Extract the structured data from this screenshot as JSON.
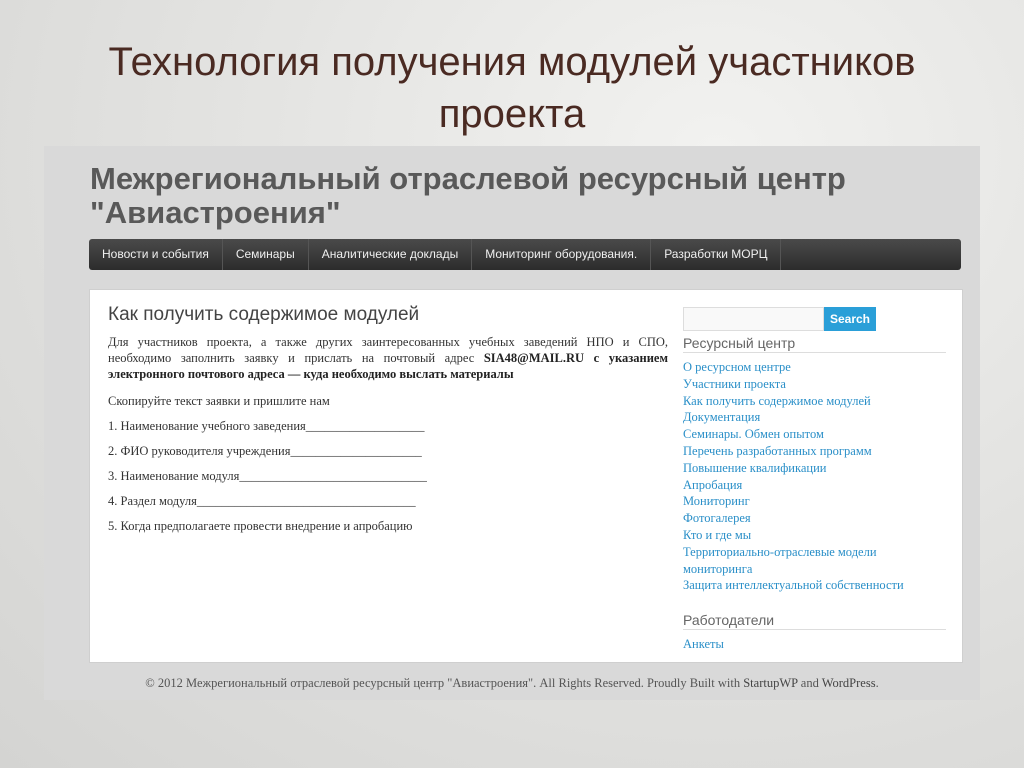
{
  "slide": {
    "title_line1": "Технология получения модулей участников",
    "title_line2": "проекта"
  },
  "site": {
    "title_line1": "Межрегиональный отраслевой ресурсный центр",
    "title_line2": "\"Авиастроения\""
  },
  "nav": {
    "items": [
      "Новости и события",
      "Семинары",
      "Аналитические доклады",
      "Мониторинг оборудования.",
      "Разработки МОРЦ"
    ]
  },
  "main": {
    "heading": "Как получить содержимое модулей",
    "intro_text": "Для участников проекта, а также других заинтересованных учебных заведений НПО и СПО, необходимо заполнить заявку и прислать на почтовый адрес ",
    "intro_bold": "SIA48@MAIL.RU с указанием электронного почтового адреса —  куда необходимо выслать материалы",
    "copy_text": "Скопируйте текст заявки и пришлите нам",
    "form_lines": [
      "1. Наименование учебного заведения___________________",
      "2. ФИО руководителя учреждения_____________________",
      "3. Наименование модуля______________________________",
      "4. Раздел модуля___________________________________",
      "5. Когда предполагаете провести внедрение и апробацию"
    ]
  },
  "sidebar": {
    "search_button": "Search",
    "widget1_title": "Ресурсный центр",
    "widget1_links": [
      "О ресурсном центре",
      "Участники проекта",
      "Как получить содержимое модулей",
      "Документация",
      "Семинары. Обмен опытом",
      "Перечень разработанных программ",
      "Повышение квалификации",
      "Апробация",
      "Мониторинг",
      "Фотогалерея",
      "Кто и где мы",
      "Территориально-отраслевые модели мониторинга",
      "Защита интеллектуальной собственности"
    ],
    "widget2_title": "Работодатели",
    "widget2_links": [
      "Анкеты"
    ]
  },
  "footer": {
    "text": "© 2012 Межрегиональный отраслевой ресурсный центр \"Авиастроения\". All Rights Reserved. Proudly Built with ",
    "link1": "StartupWP",
    "and": " and ",
    "link2": "WordPress",
    "end": "."
  },
  "colors": {
    "link": "#2a8fc8",
    "search_button": "#2a9fd8",
    "slide_title": "#4a2a22"
  }
}
